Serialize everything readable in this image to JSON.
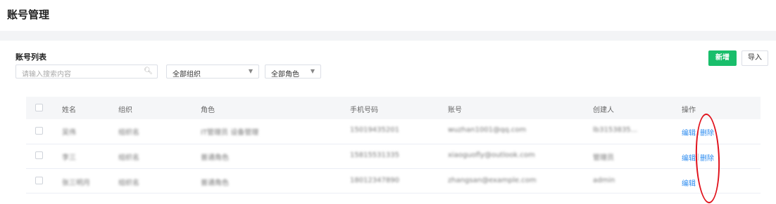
{
  "page": {
    "title": "账号管理"
  },
  "section": {
    "title": "账号列表"
  },
  "search": {
    "placeholder": "请输入搜索内容",
    "icon": "search-icon"
  },
  "filters": {
    "org": {
      "value": "全部组织"
    },
    "role": {
      "value": "全部角色"
    }
  },
  "buttons": {
    "new_label": "新增",
    "import_label": "导入"
  },
  "table": {
    "columns": [
      "姓名",
      "组织",
      "角色",
      "手机号码",
      "账号",
      "创建人",
      "操作"
    ],
    "rows": [
      {
        "name": "吴伟",
        "org": "组织名",
        "role": "IT管理员 设备管理",
        "phone": "15019435201",
        "account": "wuzhan1001@qq.com",
        "creator": "lb3153835...",
        "actions": [
          "编辑",
          "删除"
        ]
      },
      {
        "name": "李三",
        "org": "组织名",
        "role": "普通角色",
        "phone": "15815531335",
        "account": "xiaoguofly@outlook.com",
        "creator": "管理员",
        "actions": [
          "编辑",
          "删除"
        ]
      },
      {
        "name": "张三明月",
        "org": "组织名",
        "role": "普通角色",
        "phone": "18012347890",
        "account": "zhangsan@example.com",
        "creator": "admin",
        "actions": [
          "编辑"
        ]
      }
    ]
  },
  "colors": {
    "accent_green": "#19be6b",
    "link_blue": "#2d8cf0",
    "annotation_red": "#e0101a"
  }
}
